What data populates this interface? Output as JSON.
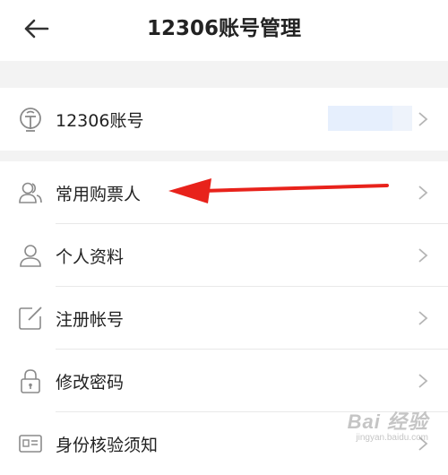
{
  "header": {
    "title": "12306账号管理",
    "back_icon": "arrow-left-icon"
  },
  "account_row": {
    "label": "12306账号",
    "icon": "railway-logo-icon",
    "value": ""
  },
  "menu": [
    {
      "label": "常用购票人",
      "icon": "passengers-icon"
    },
    {
      "label": "个人资料",
      "icon": "person-icon"
    },
    {
      "label": "注册帐号",
      "icon": "edit-square-icon"
    },
    {
      "label": "修改密码",
      "icon": "lock-icon"
    },
    {
      "label": "身份核验须知",
      "icon": "id-card-icon"
    }
  ],
  "annotation": {
    "color": "#e8221b",
    "points_to": "常用购票人"
  },
  "watermark": {
    "main": "Bai 经验",
    "sub": "jingyan.baidu.com"
  }
}
